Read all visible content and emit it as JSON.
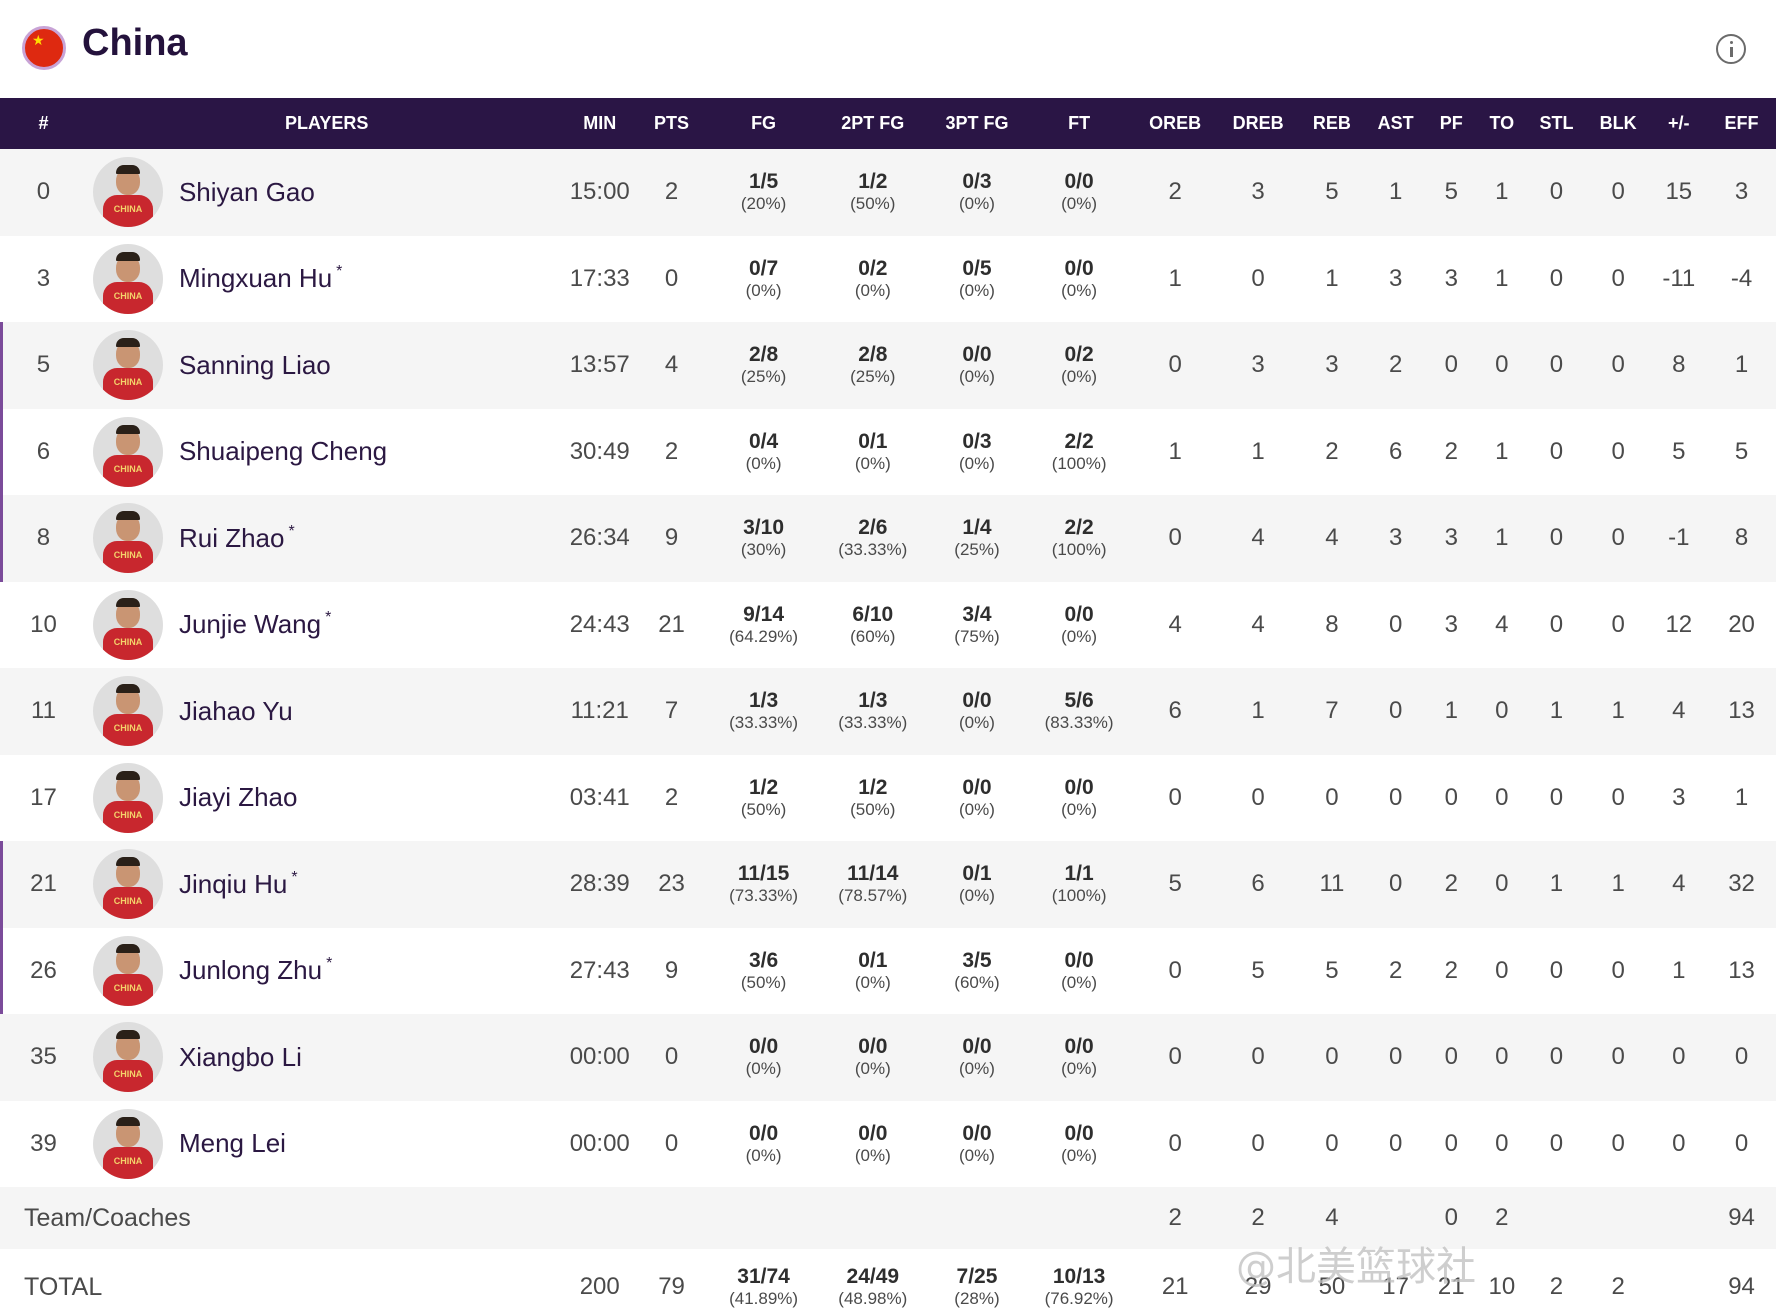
{
  "header": {
    "team": "China",
    "flag": "china-flag",
    "flag_colors": [
      "#de2910",
      "#ffde00"
    ]
  },
  "columns": [
    "#",
    "PLAYERS",
    "MIN",
    "PTS",
    "FG",
    "2PT FG",
    "3PT FG",
    "FT",
    "OREB",
    "DREB",
    "REB",
    "AST",
    "PF",
    "TO",
    "STL",
    "BLK",
    "+/-",
    "EFF"
  ],
  "players": [
    {
      "no": "0",
      "name": "Shiyan Gao",
      "star": "",
      "min": "15:00",
      "pts": "2",
      "fg": "1/5",
      "fg_pct": "(20%)",
      "fg2": "1/2",
      "fg2_pct": "(50%)",
      "fg3": "0/3",
      "fg3_pct": "(0%)",
      "ft": "0/0",
      "ft_pct": "(0%)",
      "oreb": "2",
      "dreb": "3",
      "reb": "5",
      "ast": "1",
      "pf": "5",
      "to": "1",
      "stl": "0",
      "blk": "0",
      "pm": "15",
      "eff": "3",
      "started": false
    },
    {
      "no": "3",
      "name": "Mingxuan Hu",
      "star": "*",
      "min": "17:33",
      "pts": "0",
      "fg": "0/7",
      "fg_pct": "(0%)",
      "fg2": "0/2",
      "fg2_pct": "(0%)",
      "fg3": "0/5",
      "fg3_pct": "(0%)",
      "ft": "0/0",
      "ft_pct": "(0%)",
      "oreb": "1",
      "dreb": "0",
      "reb": "1",
      "ast": "3",
      "pf": "3",
      "to": "1",
      "stl": "0",
      "blk": "0",
      "pm": "-11",
      "eff": "-4",
      "started": false
    },
    {
      "no": "5",
      "name": "Sanning Liao",
      "star": "",
      "min": "13:57",
      "pts": "4",
      "fg": "2/8",
      "fg_pct": "(25%)",
      "fg2": "2/8",
      "fg2_pct": "(25%)",
      "fg3": "0/0",
      "fg3_pct": "(0%)",
      "ft": "0/2",
      "ft_pct": "(0%)",
      "oreb": "0",
      "dreb": "3",
      "reb": "3",
      "ast": "2",
      "pf": "0",
      "to": "0",
      "stl": "0",
      "blk": "0",
      "pm": "8",
      "eff": "1",
      "started": true
    },
    {
      "no": "6",
      "name": "Shuaipeng Cheng",
      "star": "",
      "min": "30:49",
      "pts": "2",
      "fg": "0/4",
      "fg_pct": "(0%)",
      "fg2": "0/1",
      "fg2_pct": "(0%)",
      "fg3": "0/3",
      "fg3_pct": "(0%)",
      "ft": "2/2",
      "ft_pct": "(100%)",
      "oreb": "1",
      "dreb": "1",
      "reb": "2",
      "ast": "6",
      "pf": "2",
      "to": "1",
      "stl": "0",
      "blk": "0",
      "pm": "5",
      "eff": "5",
      "started": true
    },
    {
      "no": "8",
      "name": "Rui Zhao",
      "star": "*",
      "min": "26:34",
      "pts": "9",
      "fg": "3/10",
      "fg_pct": "(30%)",
      "fg2": "2/6",
      "fg2_pct": "(33.33%)",
      "fg3": "1/4",
      "fg3_pct": "(25%)",
      "ft": "2/2",
      "ft_pct": "(100%)",
      "oreb": "0",
      "dreb": "4",
      "reb": "4",
      "ast": "3",
      "pf": "3",
      "to": "1",
      "stl": "0",
      "blk": "0",
      "pm": "-1",
      "eff": "8",
      "started": true
    },
    {
      "no": "10",
      "name": "Junjie Wang",
      "star": "*",
      "min": "24:43",
      "pts": "21",
      "fg": "9/14",
      "fg_pct": "(64.29%)",
      "fg2": "6/10",
      "fg2_pct": "(60%)",
      "fg3": "3/4",
      "fg3_pct": "(75%)",
      "ft": "0/0",
      "ft_pct": "(0%)",
      "oreb": "4",
      "dreb": "4",
      "reb": "8",
      "ast": "0",
      "pf": "3",
      "to": "4",
      "stl": "0",
      "blk": "0",
      "pm": "12",
      "eff": "20",
      "started": false
    },
    {
      "no": "11",
      "name": "Jiahao Yu",
      "star": "",
      "min": "11:21",
      "pts": "7",
      "fg": "1/3",
      "fg_pct": "(33.33%)",
      "fg2": "1/3",
      "fg2_pct": "(33.33%)",
      "fg3": "0/0",
      "fg3_pct": "(0%)",
      "ft": "5/6",
      "ft_pct": "(83.33%)",
      "oreb": "6",
      "dreb": "1",
      "reb": "7",
      "ast": "0",
      "pf": "1",
      "to": "0",
      "stl": "1",
      "blk": "1",
      "pm": "4",
      "eff": "13",
      "started": false
    },
    {
      "no": "17",
      "name": "Jiayi Zhao",
      "star": "",
      "min": "03:41",
      "pts": "2",
      "fg": "1/2",
      "fg_pct": "(50%)",
      "fg2": "1/2",
      "fg2_pct": "(50%)",
      "fg3": "0/0",
      "fg3_pct": "(0%)",
      "ft": "0/0",
      "ft_pct": "(0%)",
      "oreb": "0",
      "dreb": "0",
      "reb": "0",
      "ast": "0",
      "pf": "0",
      "to": "0",
      "stl": "0",
      "blk": "0",
      "pm": "3",
      "eff": "1",
      "started": false
    },
    {
      "no": "21",
      "name": "Jinqiu Hu",
      "star": "*",
      "min": "28:39",
      "pts": "23",
      "fg": "11/15",
      "fg_pct": "(73.33%)",
      "fg2": "11/14",
      "fg2_pct": "(78.57%)",
      "fg3": "0/1",
      "fg3_pct": "(0%)",
      "ft": "1/1",
      "ft_pct": "(100%)",
      "oreb": "5",
      "dreb": "6",
      "reb": "11",
      "ast": "0",
      "pf": "2",
      "to": "0",
      "stl": "1",
      "blk": "1",
      "pm": "4",
      "eff": "32",
      "started": true
    },
    {
      "no": "26",
      "name": "Junlong Zhu",
      "star": "*",
      "min": "27:43",
      "pts": "9",
      "fg": "3/6",
      "fg_pct": "(50%)",
      "fg2": "0/1",
      "fg2_pct": "(0%)",
      "fg3": "3/5",
      "fg3_pct": "(60%)",
      "ft": "0/0",
      "ft_pct": "(0%)",
      "oreb": "0",
      "dreb": "5",
      "reb": "5",
      "ast": "2",
      "pf": "2",
      "to": "0",
      "stl": "0",
      "blk": "0",
      "pm": "1",
      "eff": "13",
      "started": true
    },
    {
      "no": "35",
      "name": "Xiangbo Li",
      "star": "",
      "min": "00:00",
      "pts": "0",
      "fg": "0/0",
      "fg_pct": "(0%)",
      "fg2": "0/0",
      "fg2_pct": "(0%)",
      "fg3": "0/0",
      "fg3_pct": "(0%)",
      "ft": "0/0",
      "ft_pct": "(0%)",
      "oreb": "0",
      "dreb": "0",
      "reb": "0",
      "ast": "0",
      "pf": "0",
      "to": "0",
      "stl": "0",
      "blk": "0",
      "pm": "0",
      "eff": "0",
      "started": false
    },
    {
      "no": "39",
      "name": "Meng Lei",
      "star": "",
      "min": "00:00",
      "pts": "0",
      "fg": "0/0",
      "fg_pct": "(0%)",
      "fg2": "0/0",
      "fg2_pct": "(0%)",
      "fg3": "0/0",
      "fg3_pct": "(0%)",
      "ft": "0/0",
      "ft_pct": "(0%)",
      "oreb": "0",
      "dreb": "0",
      "reb": "0",
      "ast": "0",
      "pf": "0",
      "to": "0",
      "stl": "0",
      "blk": "0",
      "pm": "0",
      "eff": "0",
      "started": false
    }
  ],
  "team_row": {
    "label": "Team/Coaches",
    "oreb": "2",
    "dreb": "2",
    "reb": "4",
    "pf": "0",
    "to": "2",
    "eff": "94"
  },
  "total_row": {
    "label": "TOTAL",
    "min": "200",
    "pts": "79",
    "fg": "31/74",
    "fg_pct": "(41.89%)",
    "fg2": "24/49",
    "fg2_pct": "(48.98%)",
    "fg3": "7/25",
    "fg3_pct": "(28%)",
    "ft": "10/13",
    "ft_pct": "(76.92%)",
    "oreb": "21",
    "dreb": "29",
    "reb": "50",
    "ast": "17",
    "pf": "21",
    "to": "10",
    "stl": "2",
    "blk": "2",
    "eff": "94"
  },
  "avatar_jersey_text": "CHINA",
  "watermark": "@北美篮球社"
}
